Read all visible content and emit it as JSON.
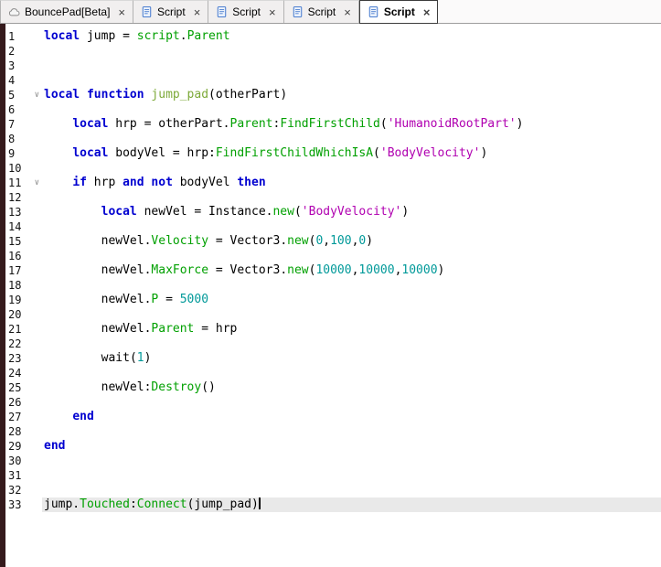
{
  "tab_bar": {
    "close_glyph": "×",
    "tabs": [
      {
        "label": "BouncePad[Beta]",
        "icon": "place-icon",
        "active": false
      },
      {
        "label": "Script",
        "icon": "script-icon",
        "active": false
      },
      {
        "label": "Script",
        "icon": "script-icon",
        "active": false
      },
      {
        "label": "Script",
        "icon": "script-icon",
        "active": false
      },
      {
        "label": "Script",
        "icon": "script-icon",
        "active": true
      }
    ]
  },
  "editor": {
    "language": "lua",
    "active_line": 33,
    "fold_glyph": "∨",
    "fold_lines": [
      5,
      11
    ],
    "colors": {
      "keyword": "#0000D0",
      "builtin": "#00A000",
      "string": "#B000B0",
      "number": "#009999",
      "function_name": "#7CA938",
      "plain": "#000000",
      "line_highlight": "#E9E9E9",
      "gutter_edge": "#351A1C"
    },
    "lines": [
      {
        "n": 1,
        "indent": 0,
        "tokens": [
          [
            "local",
            "k"
          ],
          [
            " jump = ",
            "p"
          ],
          [
            "script",
            "g"
          ],
          [
            ".",
            "p"
          ],
          [
            "Parent",
            "g"
          ]
        ]
      },
      {
        "n": 2,
        "indent": 0,
        "tokens": []
      },
      {
        "n": 3,
        "indent": 0,
        "tokens": []
      },
      {
        "n": 4,
        "indent": 0,
        "tokens": []
      },
      {
        "n": 5,
        "indent": 0,
        "tokens": [
          [
            "local",
            "k"
          ],
          [
            " ",
            "p"
          ],
          [
            "function",
            "k"
          ],
          [
            " ",
            "p"
          ],
          [
            "jump_pad",
            "f"
          ],
          [
            "(otherPart)",
            "p"
          ]
        ]
      },
      {
        "n": 6,
        "indent": 0,
        "tokens": []
      },
      {
        "n": 7,
        "indent": 1,
        "tokens": [
          [
            "local",
            "k"
          ],
          [
            " hrp = otherPart.",
            "p"
          ],
          [
            "Parent",
            "g"
          ],
          [
            ":",
            "p"
          ],
          [
            "FindFirstChild",
            "g"
          ],
          [
            "(",
            "p"
          ],
          [
            "'HumanoidRootPart'",
            "s"
          ],
          [
            ")",
            "p"
          ]
        ]
      },
      {
        "n": 8,
        "indent": 0,
        "tokens": []
      },
      {
        "n": 9,
        "indent": 1,
        "tokens": [
          [
            "local",
            "k"
          ],
          [
            " bodyVel = hrp:",
            "p"
          ],
          [
            "FindFirstChildWhichIsA",
            "g"
          ],
          [
            "(",
            "p"
          ],
          [
            "'BodyVelocity'",
            "s"
          ],
          [
            ")",
            "p"
          ]
        ]
      },
      {
        "n": 10,
        "indent": 0,
        "tokens": []
      },
      {
        "n": 11,
        "indent": 1,
        "tokens": [
          [
            "if",
            "k"
          ],
          [
            " hrp ",
            "p"
          ],
          [
            "and",
            "k"
          ],
          [
            " ",
            "p"
          ],
          [
            "not",
            "k"
          ],
          [
            " bodyVel ",
            "p"
          ],
          [
            "then",
            "k"
          ]
        ]
      },
      {
        "n": 12,
        "indent": 0,
        "tokens": []
      },
      {
        "n": 13,
        "indent": 2,
        "tokens": [
          [
            "local",
            "k"
          ],
          [
            " newVel = Instance.",
            "p"
          ],
          [
            "new",
            "g"
          ],
          [
            "(",
            "p"
          ],
          [
            "'BodyVelocity'",
            "s"
          ],
          [
            ")",
            "p"
          ]
        ]
      },
      {
        "n": 14,
        "indent": 0,
        "tokens": []
      },
      {
        "n": 15,
        "indent": 2,
        "tokens": [
          [
            "newVel.",
            "p"
          ],
          [
            "Velocity",
            "g"
          ],
          [
            " = Vector3.",
            "p"
          ],
          [
            "new",
            "g"
          ],
          [
            "(",
            "p"
          ],
          [
            "0",
            "n"
          ],
          [
            ",",
            "p"
          ],
          [
            "100",
            "n"
          ],
          [
            ",",
            "p"
          ],
          [
            "0",
            "n"
          ],
          [
            ")",
            "p"
          ]
        ]
      },
      {
        "n": 16,
        "indent": 0,
        "tokens": []
      },
      {
        "n": 17,
        "indent": 2,
        "tokens": [
          [
            "newVel.",
            "p"
          ],
          [
            "MaxForce",
            "g"
          ],
          [
            " = Vector3.",
            "p"
          ],
          [
            "new",
            "g"
          ],
          [
            "(",
            "p"
          ],
          [
            "10000",
            "n"
          ],
          [
            ",",
            "p"
          ],
          [
            "10000",
            "n"
          ],
          [
            ",",
            "p"
          ],
          [
            "10000",
            "n"
          ],
          [
            ")",
            "p"
          ]
        ]
      },
      {
        "n": 18,
        "indent": 0,
        "tokens": []
      },
      {
        "n": 19,
        "indent": 2,
        "tokens": [
          [
            "newVel.",
            "p"
          ],
          [
            "P",
            "g"
          ],
          [
            " = ",
            "p"
          ],
          [
            "5000",
            "n"
          ]
        ]
      },
      {
        "n": 20,
        "indent": 0,
        "tokens": []
      },
      {
        "n": 21,
        "indent": 2,
        "tokens": [
          [
            "newVel.",
            "p"
          ],
          [
            "Parent",
            "g"
          ],
          [
            " = hrp",
            "p"
          ]
        ]
      },
      {
        "n": 22,
        "indent": 0,
        "tokens": []
      },
      {
        "n": 23,
        "indent": 2,
        "tokens": [
          [
            "wait",
            "p"
          ],
          [
            "(",
            "p"
          ],
          [
            "1",
            "n"
          ],
          [
            ")",
            "p"
          ]
        ]
      },
      {
        "n": 24,
        "indent": 0,
        "tokens": []
      },
      {
        "n": 25,
        "indent": 2,
        "tokens": [
          [
            "newVel:",
            "p"
          ],
          [
            "Destroy",
            "g"
          ],
          [
            "()",
            "p"
          ]
        ]
      },
      {
        "n": 26,
        "indent": 0,
        "tokens": []
      },
      {
        "n": 27,
        "indent": 1,
        "tokens": [
          [
            "end",
            "k"
          ]
        ]
      },
      {
        "n": 28,
        "indent": 0,
        "tokens": []
      },
      {
        "n": 29,
        "indent": 0,
        "tokens": [
          [
            "end",
            "k"
          ]
        ]
      },
      {
        "n": 30,
        "indent": 0,
        "tokens": []
      },
      {
        "n": 31,
        "indent": 0,
        "tokens": []
      },
      {
        "n": 32,
        "indent": 0,
        "tokens": []
      },
      {
        "n": 33,
        "indent": 0,
        "tokens": [
          [
            "jump.",
            "p"
          ],
          [
            "Touched",
            "g"
          ],
          [
            ":",
            "p"
          ],
          [
            "Connect",
            "g"
          ],
          [
            "(jump_pad)",
            "p"
          ]
        ]
      }
    ]
  }
}
